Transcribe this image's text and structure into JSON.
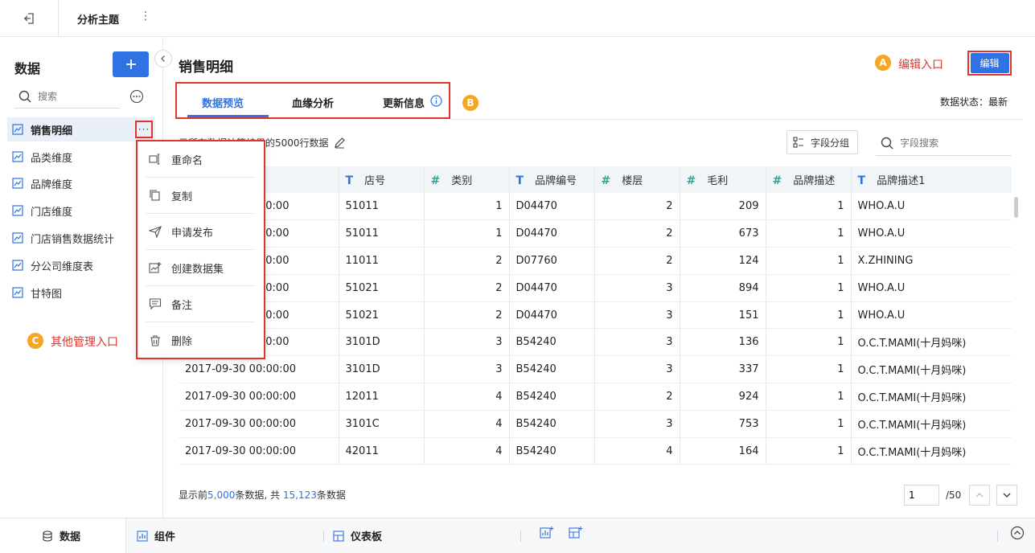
{
  "topbar": {
    "title": "分析主题",
    "more": "⋮"
  },
  "sidebar": {
    "title": "数据",
    "search_placeholder": "搜索",
    "items": [
      {
        "label": "销售明细"
      },
      {
        "label": "品类维度"
      },
      {
        "label": "品牌维度"
      },
      {
        "label": "门店维度"
      },
      {
        "label": "门店销售数据统计"
      },
      {
        "label": "分公司维度表"
      },
      {
        "label": "甘特图"
      }
    ],
    "more_label": "···"
  },
  "context_menu": {
    "items": [
      {
        "label": "重命名",
        "icon": "rename-icon"
      },
      {
        "label": "复制",
        "icon": "copy-icon"
      },
      {
        "label": "申请发布",
        "icon": "send-icon"
      },
      {
        "label": "创建数据集",
        "icon": "create-dataset-icon"
      },
      {
        "label": "备注",
        "icon": "comment-icon"
      },
      {
        "label": "删除",
        "icon": "trash-icon"
      }
    ]
  },
  "annotations": {
    "a_badge": "A",
    "a_text": "编辑入口",
    "b_badge": "B",
    "c_badge": "C",
    "c_text": "其他管理入口"
  },
  "main": {
    "title": "销售明细",
    "edit_label": "编辑",
    "tabs": [
      {
        "label": "数据预览",
        "active": true
      },
      {
        "label": "血缘分析",
        "active": false
      },
      {
        "label": "更新信息",
        "active": false
      }
    ],
    "status": "数据状态：最新",
    "hint": "示所有数据计算结果的5000行数据",
    "field_group_label": "字段分组",
    "field_search_placeholder": "字段搜索"
  },
  "table": {
    "columns": [
      {
        "label": "",
        "type": "none"
      },
      {
        "label": "店号",
        "type": "text"
      },
      {
        "label": "类别",
        "type": "number"
      },
      {
        "label": "品牌编号",
        "type": "text"
      },
      {
        "label": "楼层",
        "type": "number"
      },
      {
        "label": "毛利",
        "type": "number"
      },
      {
        "label": "品牌描述",
        "type": "number"
      },
      {
        "label": "品牌描述1",
        "type": "text"
      }
    ],
    "rows": [
      [
        "00:00",
        "51011",
        "1",
        "D04470",
        "2",
        "209",
        "1",
        "WHO.A.U"
      ],
      [
        "00:00",
        "51011",
        "1",
        "D04470",
        "2",
        "673",
        "1",
        "WHO.A.U"
      ],
      [
        "00:00",
        "11011",
        "2",
        "D07760",
        "2",
        "124",
        "1",
        "X.ZHINING"
      ],
      [
        "00:00",
        "51021",
        "2",
        "D04470",
        "3",
        "894",
        "1",
        "WHO.A.U"
      ],
      [
        "00:00",
        "51021",
        "2",
        "D04470",
        "3",
        "151",
        "1",
        "WHO.A.U"
      ],
      [
        "00:00",
        "3101D",
        "3",
        "B54240",
        "3",
        "136",
        "1",
        "O.C.T.MAMI(十月妈咪)"
      ],
      [
        "2017-09-30 00:00:00",
        "3101D",
        "3",
        "B54240",
        "3",
        "337",
        "1",
        "O.C.T.MAMI(十月妈咪)"
      ],
      [
        "2017-09-30 00:00:00",
        "12011",
        "4",
        "B54240",
        "2",
        "924",
        "1",
        "O.C.T.MAMI(十月妈咪)"
      ],
      [
        "2017-09-30 00:00:00",
        "3101C",
        "4",
        "B54240",
        "3",
        "753",
        "1",
        "O.C.T.MAMI(十月妈咪)"
      ],
      [
        "2017-09-30 00:00:00",
        "42011",
        "4",
        "B54240",
        "4",
        "164",
        "1",
        "O.C.T.MAMI(十月妈咪)"
      ]
    ]
  },
  "footer": {
    "prefix": "显示前",
    "shown": "5,000",
    "mid": "条数据, 共",
    "total": "15,123",
    "suffix": "条数据",
    "page_value": "1",
    "page_total": "/50"
  },
  "bottombar": {
    "data_label": "数据",
    "component_label": "组件",
    "dashboard_label": "仪表板"
  },
  "colors": {
    "accent": "#2e72e3",
    "annotation": "#f5a623",
    "highlight": "#e2342b"
  }
}
